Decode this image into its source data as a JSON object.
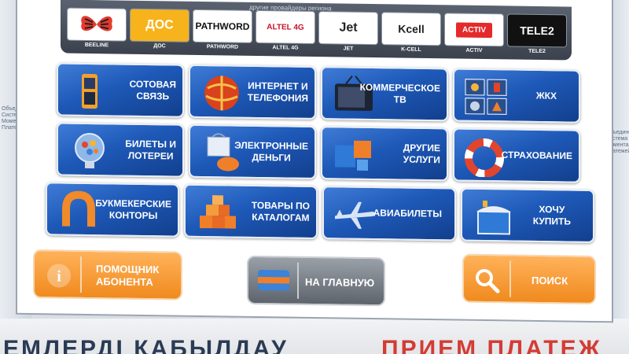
{
  "providers": {
    "title": "другие провайдеры региона",
    "items": [
      {
        "name": "BEELINE",
        "logo": "beeline-butterfly"
      },
      {
        "name": "ДОС",
        "logo": "ДОС"
      },
      {
        "name": "PATHWORD",
        "logo": "PATHWORD"
      },
      {
        "name": "ALTEL 4G",
        "logo": "ALTEL 4G"
      },
      {
        "name": "JET",
        "logo": "Jet"
      },
      {
        "name": "K-CELL",
        "logo": "Kcell"
      },
      {
        "name": "ACTIV",
        "logo": "ACTIV"
      },
      {
        "name": "TELE2",
        "logo": "TELE2"
      }
    ]
  },
  "services": {
    "mobile": "СОТОВАЯ\nСВЯЗЬ",
    "internet": "ИНТЕРНЕТ И\nТЕЛЕФОНИЯ",
    "commercial_tv": "КОММЕРЧЕСКОЕ\nТВ",
    "utilities": "ЖКХ",
    "lottery": "БИЛЕТЫ И\nЛОТЕРЕИ",
    "emoney": "ЭЛЕКТРОННЫЕ\nДЕНЬГИ",
    "other": "ДРУГИЕ\nУСЛУГИ",
    "insurance": "СТРАХОВАНИЕ",
    "bookmakers": "БУКМЕКЕРСКИЕ\nКОНТОРЫ",
    "catalog": "ТОВАРЫ ПО\nКАТАЛОГАМ",
    "flights": "АВИАБИЛЕТЫ",
    "wish": "ХОЧУ\nКУПИТЬ"
  },
  "bottom": {
    "help": "ПОМОЩНИК\nАБОНЕНТА",
    "home": "НА ГЛАВНУЮ",
    "search": "ПОИСК"
  },
  "kiosk": {
    "banner_left": "ЕМЛЕРДІ ҚАБЫЛДАУ",
    "banner_right": "ПРИЕМ ПЛАТЕЖ",
    "side_right": "Объединенная Система Моментальных Платежей",
    "side_left": "Объединенная Система Моментальных Платежей"
  },
  "colors": {
    "tile_blue": "#1e59b8",
    "button_orange": "#f08a1e",
    "button_gray": "#5e646c"
  }
}
